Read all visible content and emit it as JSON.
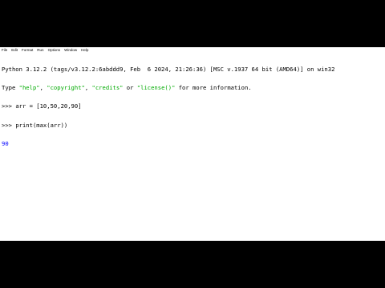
{
  "menu": {
    "items": [
      "File",
      "Edit",
      "Format",
      "Run",
      "Options",
      "Window",
      "Help"
    ]
  },
  "shell": {
    "banner": "Python 3.12.2 (tags/v3.12.2:6abddd9, Feb  6 2024, 21:26:36) [MSC v.1937 64 bit (AMD64)] on win32",
    "type_prefix": "Type ",
    "help_str": "\"help\"",
    "sep1": ", ",
    "copyright_str": "\"copyright\"",
    "sep2": ", ",
    "credits_str": "\"credits\"",
    "or_word": " or ",
    "license_str": "\"license()\"",
    "type_suffix": " for more information.",
    "prompt1": ">>> ",
    "cmd1": "arr = [10,50,20,90]",
    "prompt2": ">>> ",
    "cmd2": "print(max(arr))",
    "output": "90"
  },
  "colors": {
    "string": "#00aa00",
    "output": "#0000ff",
    "background": "#ffffff"
  }
}
